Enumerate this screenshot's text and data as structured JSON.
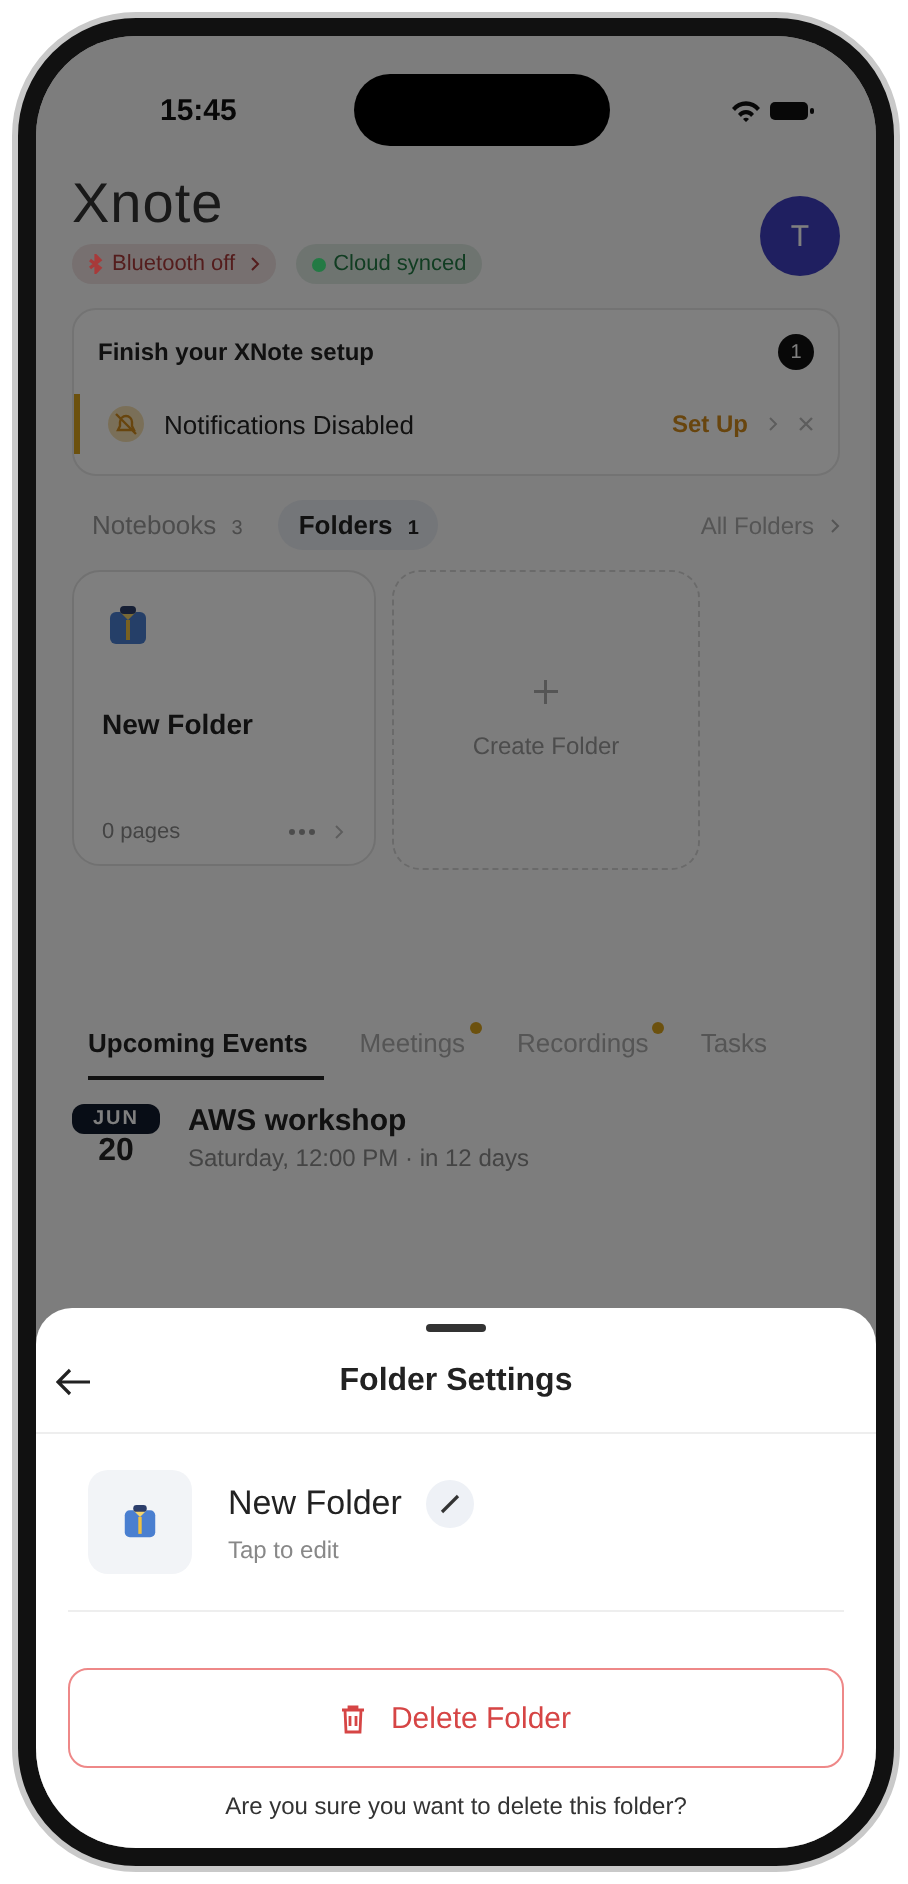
{
  "status_bar": {
    "time": "15:45"
  },
  "app": {
    "logo": "Xnote",
    "avatar": "T"
  },
  "chips": [
    {
      "kind": "bluetooth",
      "label": "Bluetooth off",
      "color": "#a83a3a"
    },
    {
      "kind": "cloud",
      "label": "Cloud synced",
      "color": "#237a44"
    }
  ],
  "setup": {
    "title": "Finish your XNote setup",
    "count": "1",
    "item": {
      "label": "Notifications Disabled",
      "action": "Set Up"
    }
  },
  "section_tabs": [
    {
      "label": "Notebooks",
      "count": "3",
      "selected": false
    },
    {
      "label": "Folders",
      "count": "1",
      "selected": true
    }
  ],
  "all_link": "All Folders",
  "folders": [
    {
      "name": "New Folder",
      "pages": "0 pages"
    }
  ],
  "create_folder": "Create Folder",
  "event_tabs": [
    {
      "label": "Upcoming Events",
      "selected": true,
      "dot": false
    },
    {
      "label": "Meetings",
      "selected": false,
      "dot": true
    },
    {
      "label": "Recordings",
      "selected": false,
      "dot": true
    },
    {
      "label": "Tasks",
      "selected": false,
      "dot": false
    }
  ],
  "events": [
    {
      "month": "JUN",
      "day": "20",
      "title": "AWS workshop",
      "subtitle": "Saturday, 12:00 PM · in 12 days"
    }
  ],
  "sheet": {
    "title": "Folder Settings",
    "folder_name": "New Folder",
    "hint": "Tap to edit",
    "delete_label": "Delete Folder",
    "confirm": "Are you sure you want to delete this folder?"
  }
}
